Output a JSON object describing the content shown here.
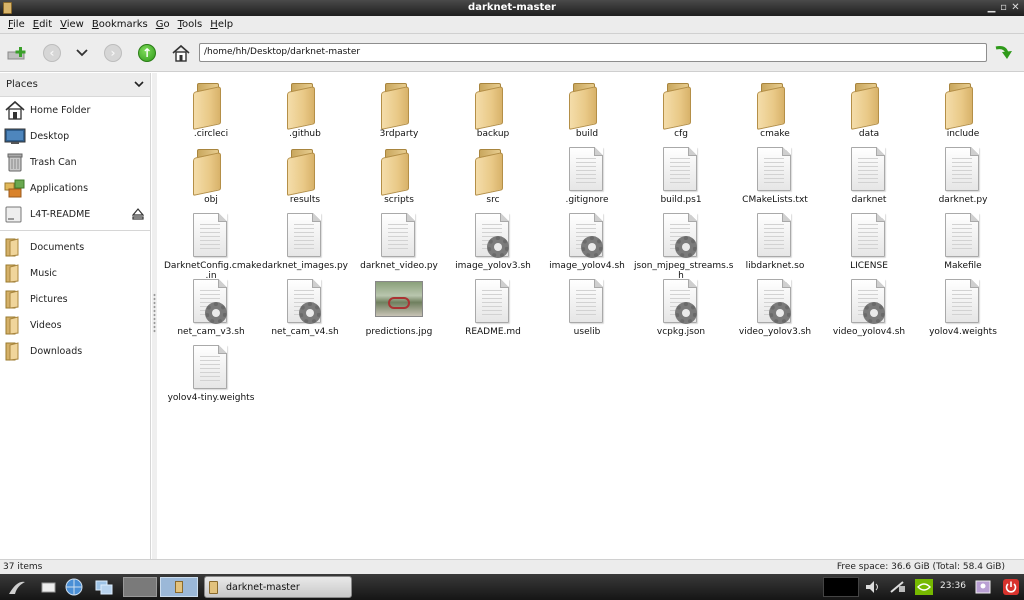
{
  "window": {
    "title": "darknet-master"
  },
  "menu": {
    "items": [
      {
        "label": "File",
        "u": "F",
        "rest": "ile"
      },
      {
        "label": "Edit",
        "u": "E",
        "rest": "dit"
      },
      {
        "label": "View",
        "u": "V",
        "rest": "iew"
      },
      {
        "label": "Bookmarks",
        "u": "B",
        "rest": "ookmarks"
      },
      {
        "label": "Go",
        "u": "G",
        "rest": "o"
      },
      {
        "label": "Tools",
        "u": "T",
        "rest": "ools"
      },
      {
        "label": "Help",
        "u": "H",
        "rest": "elp"
      }
    ]
  },
  "toolbar": {
    "path": "/home/hh/Desktop/darknet-master"
  },
  "sidebar": {
    "header": "Places",
    "places": [
      {
        "label": "Home Folder",
        "icon": "home-icon"
      },
      {
        "label": "Desktop",
        "icon": "desktop-icon"
      },
      {
        "label": "Trash Can",
        "icon": "trash-icon"
      },
      {
        "label": "Applications",
        "icon": "applications-icon"
      },
      {
        "label": "L4T-README",
        "icon": "drive-icon"
      }
    ],
    "bookmarks": [
      {
        "label": "Documents"
      },
      {
        "label": "Music"
      },
      {
        "label": "Pictures"
      },
      {
        "label": "Videos"
      },
      {
        "label": "Downloads"
      }
    ]
  },
  "files": [
    {
      "name": ".circleci",
      "type": "folder"
    },
    {
      "name": ".github",
      "type": "folder"
    },
    {
      "name": "3rdparty",
      "type": "folder"
    },
    {
      "name": "backup",
      "type": "folder"
    },
    {
      "name": "build",
      "type": "folder"
    },
    {
      "name": "cfg",
      "type": "folder"
    },
    {
      "name": "cmake",
      "type": "folder"
    },
    {
      "name": "data",
      "type": "folder"
    },
    {
      "name": "include",
      "type": "folder"
    },
    {
      "name": "obj",
      "type": "folder"
    },
    {
      "name": "results",
      "type": "folder"
    },
    {
      "name": "scripts",
      "type": "folder"
    },
    {
      "name": "src",
      "type": "folder"
    },
    {
      "name": ".gitignore",
      "type": "doc"
    },
    {
      "name": "build.ps1",
      "type": "doc"
    },
    {
      "name": "CMakeLists.txt",
      "type": "doc"
    },
    {
      "name": "darknet",
      "type": "doc"
    },
    {
      "name": "darknet.py",
      "type": "doc"
    },
    {
      "name": "DarknetConfig.cmake\n.in",
      "type": "doc"
    },
    {
      "name": "darknet_images.py",
      "type": "doc"
    },
    {
      "name": "darknet_video.py",
      "type": "doc"
    },
    {
      "name": "image_yolov3.sh",
      "type": "script"
    },
    {
      "name": "image_yolov4.sh",
      "type": "script"
    },
    {
      "name": "json_mjpeg_streams.s\nh",
      "type": "script"
    },
    {
      "name": "libdarknet.so",
      "type": "doc"
    },
    {
      "name": "LICENSE",
      "type": "doc"
    },
    {
      "name": "Makefile",
      "type": "doc"
    },
    {
      "name": "net_cam_v3.sh",
      "type": "script"
    },
    {
      "name": "net_cam_v4.sh",
      "type": "script"
    },
    {
      "name": "predictions.jpg",
      "type": "image"
    },
    {
      "name": "README.md",
      "type": "doc"
    },
    {
      "name": "uselib",
      "type": "doc"
    },
    {
      "name": "vcpkg.json",
      "type": "script"
    },
    {
      "name": "video_yolov3.sh",
      "type": "script"
    },
    {
      "name": "video_yolov4.sh",
      "type": "script"
    },
    {
      "name": "yolov4.weights",
      "type": "doc"
    },
    {
      "name": "yolov4-tiny.weights",
      "type": "doc"
    }
  ],
  "status": {
    "items": "37 items",
    "free": "Free space: 36.6 GiB (Total: 58.4 GiB)"
  },
  "taskbar": {
    "window_label": "darknet-master",
    "clock": "23:36"
  },
  "colors": {
    "folder": "#e9c987",
    "accent_green": "#2f9a1a",
    "titlebar": "#2a2a2a"
  }
}
